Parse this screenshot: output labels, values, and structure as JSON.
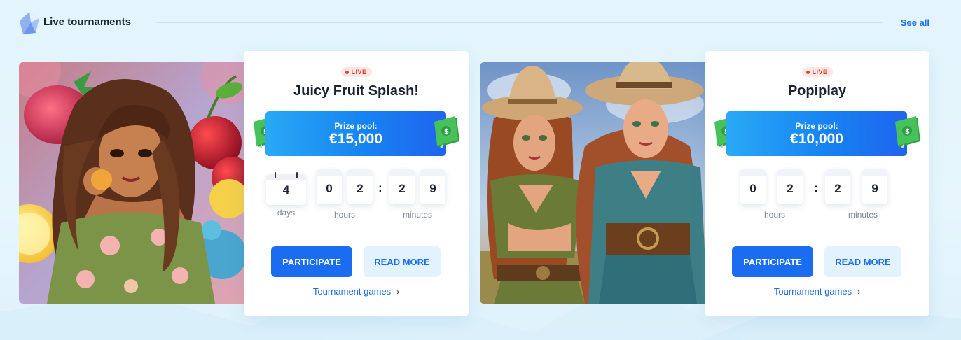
{
  "header": {
    "title": "Live tournaments",
    "see_all": "See all"
  },
  "colors": {
    "accent": "#1a6df0",
    "live": "#e0402a",
    "prize_gradient_start": "#29a9f5",
    "prize_gradient_end": "#2064ee"
  },
  "tournaments": [
    {
      "badge": "LIVE",
      "title": "Juicy Fruit Splash!",
      "prize_label": "Prize pool:",
      "prize_amount": "€15,000",
      "countdown": {
        "days": "4",
        "hours": [
          "0",
          "2"
        ],
        "minutes": [
          "2",
          "9"
        ],
        "days_label": "days",
        "hours_label": "hours",
        "minutes_label": "minutes"
      },
      "participate": "PARTICIPATE",
      "read_more": "READ MORE",
      "games_link": "Tournament games",
      "icon": "money-stack-icon"
    },
    {
      "badge": "LIVE",
      "title": "Popiplay",
      "prize_label": "Prize pool:",
      "prize_amount": "€10,000",
      "countdown": {
        "hours": [
          "0",
          "2"
        ],
        "minutes": [
          "2",
          "9"
        ],
        "hours_label": "hours",
        "minutes_label": "minutes"
      },
      "participate": "PARTICIPATE",
      "read_more": "READ MORE",
      "games_link": "Tournament games",
      "icon": "money-stack-icon"
    }
  ]
}
